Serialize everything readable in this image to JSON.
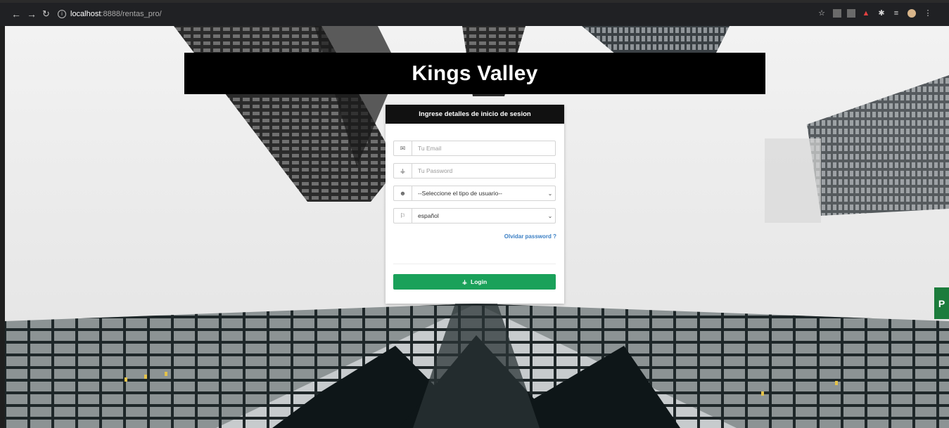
{
  "browser": {
    "url_host": "localhost",
    "url_path": ":8888/rentas_pro/",
    "back_icon": "arrow-left-icon",
    "forward_icon": "arrow-right-icon",
    "reload_icon": "reload-icon",
    "info_icon": "info-circle-icon",
    "extensions": [
      "star-icon",
      "extension-a-icon",
      "extension-b-icon",
      "extension-red-icon",
      "extension-puzzle-icon",
      "reading-list-icon",
      "profile-avatar-icon",
      "kebab-menu-icon"
    ]
  },
  "page": {
    "brand": "Kings Valley",
    "login_card": {
      "header": "Ingrese detalles de inicio de sesion",
      "email_placeholder": "Tu Email",
      "email_icon": "envelope-icon",
      "password_placeholder": "Tu Password",
      "password_icon": "key-icon",
      "user_type_selected": "--Seleccione el tipo de usuario--",
      "user_type_icon": "users-icon",
      "language_selected": "español",
      "language_icon": "flag-icon",
      "forgot_link": "Olvidar password ?",
      "login_label": "Login",
      "login_icon": "key-icon"
    },
    "side_tab_label": "P",
    "colors": {
      "banner_bg": "#000000",
      "card_header_bg": "#111111",
      "login_button": "#1aa15a",
      "link": "#3b7fc4"
    }
  }
}
